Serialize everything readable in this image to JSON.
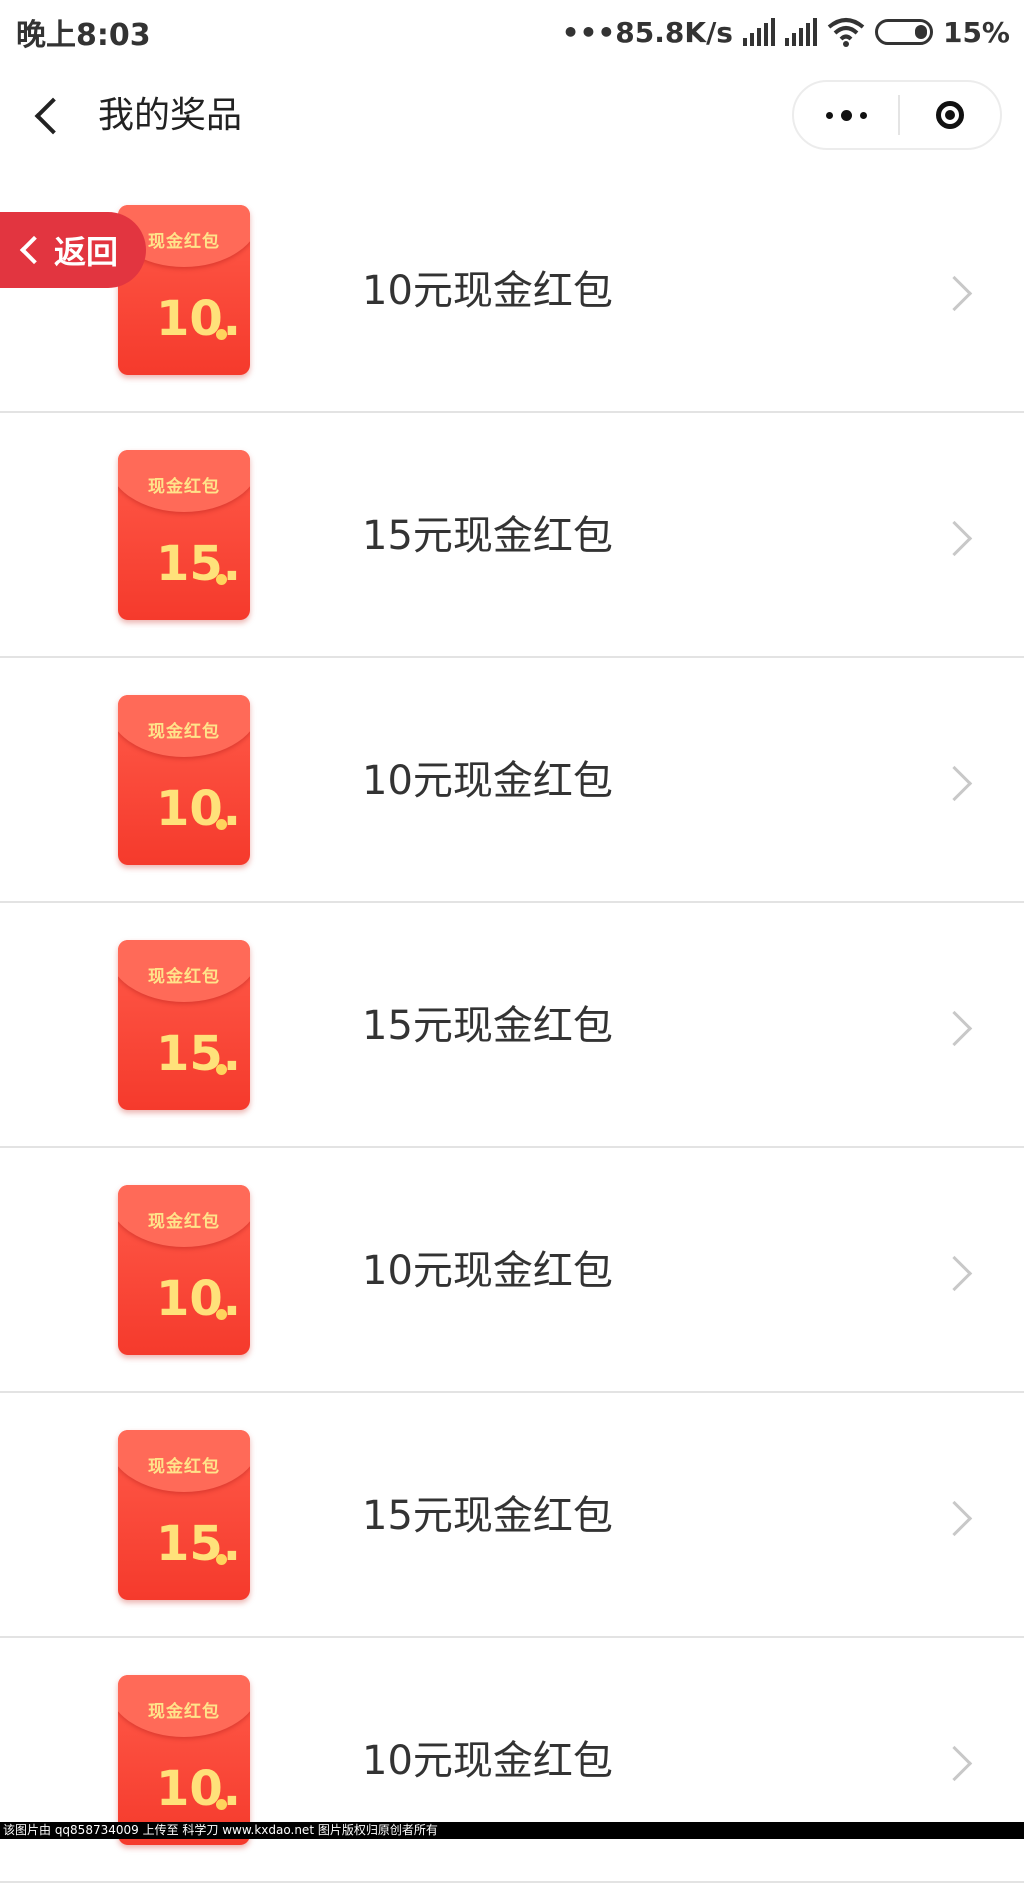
{
  "status_bar": {
    "time": "晚上8:03",
    "network_speed": "•••85.8K/s",
    "battery_percent": "15%",
    "signal_icon": "signal-icon",
    "wifi_icon": "wifi-icon",
    "battery_icon": "battery-icon"
  },
  "nav": {
    "title": "我的奖品",
    "back_icon": "back-arrow-icon",
    "more_icon": "more-icon",
    "close_icon": "mini-program-close-icon"
  },
  "floating_return": {
    "label": "返回"
  },
  "envelope_label": "现金红包",
  "prizes": [
    {
      "amount": "10.",
      "name": "10元现金红包"
    },
    {
      "amount": "15.",
      "name": "15元现金红包"
    },
    {
      "amount": "10.",
      "name": "10元现金红包"
    },
    {
      "amount": "15.",
      "name": "15元现金红包"
    },
    {
      "amount": "10.",
      "name": "10元现金红包"
    },
    {
      "amount": "15.",
      "name": "15元现金红包"
    },
    {
      "amount": "10.",
      "name": "10元现金红包"
    }
  ],
  "watermark": "该图片由 qq858734009 上传至 科学刀 www.kxdao.net 图片版权归原创者所有",
  "colors": {
    "return_button": "#e23540",
    "envelope_red": "#f53a2c",
    "envelope_gold": "#ffe17a"
  }
}
